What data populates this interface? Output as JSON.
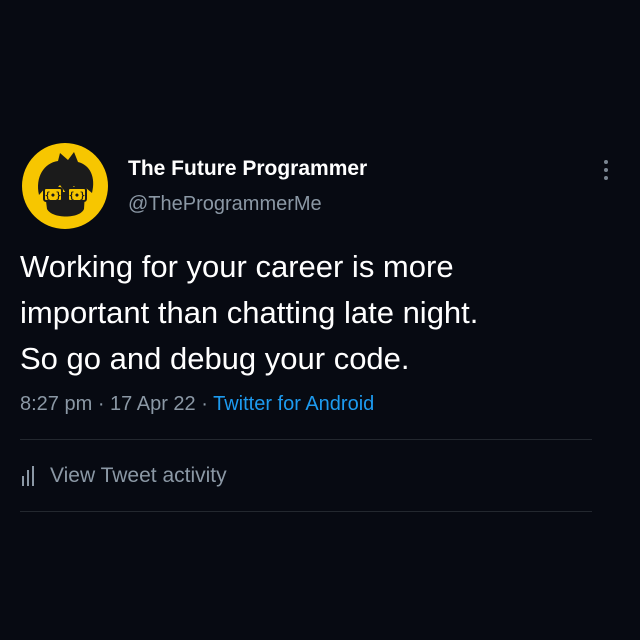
{
  "tweet": {
    "author": {
      "name": "The Future Programmer",
      "handle": "@TheProgrammerMe",
      "avatar_icon": "programmer-avatar-icon"
    },
    "text": "Working for your career is more\nimportant than chatting late night.\nSo go and debug your code.",
    "time": "8:27 pm",
    "separator": " · ",
    "date": "17 Apr 22",
    "source": "Twitter for Android",
    "activity_label": "View Tweet activity",
    "activity_icon": "bar-chart-icon",
    "more_icon": "more-vertical-icon"
  },
  "colors": {
    "background": "#070a12",
    "text": "#ffffff",
    "secondary_text": "#8b98a5",
    "link": "#1d9bf0",
    "avatar_background": "#f7c600",
    "divider": "#23282f"
  }
}
